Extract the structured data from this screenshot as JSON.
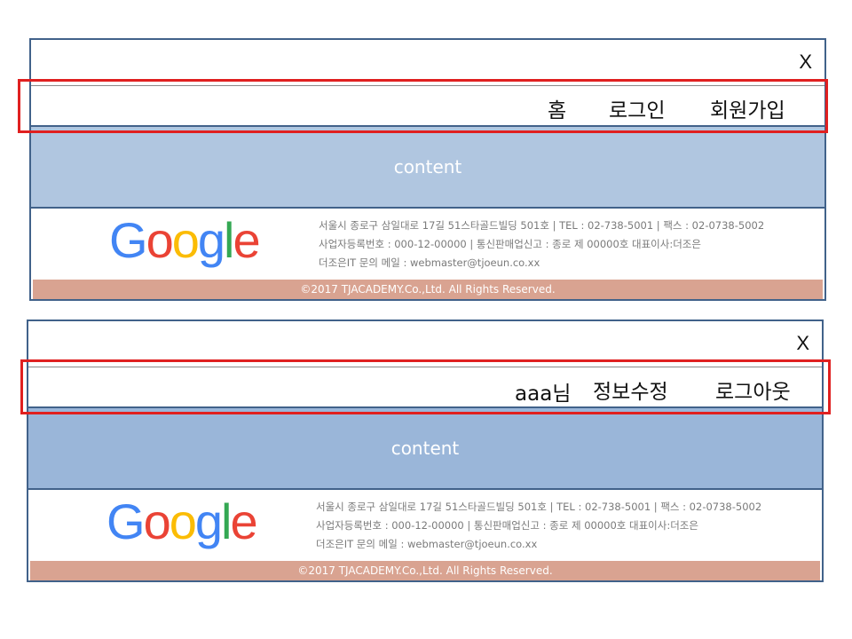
{
  "common": {
    "close_label": "X",
    "content_label": "content",
    "footer": {
      "address_line": "서울시 종로구 삼일대로 17길 51스타골드빌딩 501호 | TEL : 02-738-5001 | 팩스 : 02-0738-5002",
      "registration_line": "사업자등록번호 : 000-12-00000 | 통신판매업신고 : 종로 제 00000호 대표이사:더조은",
      "email_line": "더조은IT 문의 메일 : webmaster@tjoeun.co.xx",
      "copyright": "©2017 TJACADEMY.Co.,Ltd. All Rights Reserved.",
      "logo_letters": [
        "G",
        "o",
        "o",
        "g",
        "l",
        "e"
      ],
      "logo_colors": [
        "#4285f4",
        "#ea4335",
        "#fbbc05",
        "#4285f4",
        "#34a853",
        "#ea4335"
      ]
    }
  },
  "logged_out": {
    "nav": {
      "home": "홈",
      "login": "로그인",
      "signup": "회원가입"
    }
  },
  "logged_in": {
    "nav": {
      "user_greeting": "aaa님",
      "edit_profile": "정보수정",
      "logout": "로그아웃"
    }
  },
  "colors": {
    "frame_border": "#41628a",
    "highlight": "#e02020",
    "content_bg_1": "#b0c6e0",
    "content_bg_2": "#9ab6d9",
    "copyright_bg": "#d9a391"
  }
}
